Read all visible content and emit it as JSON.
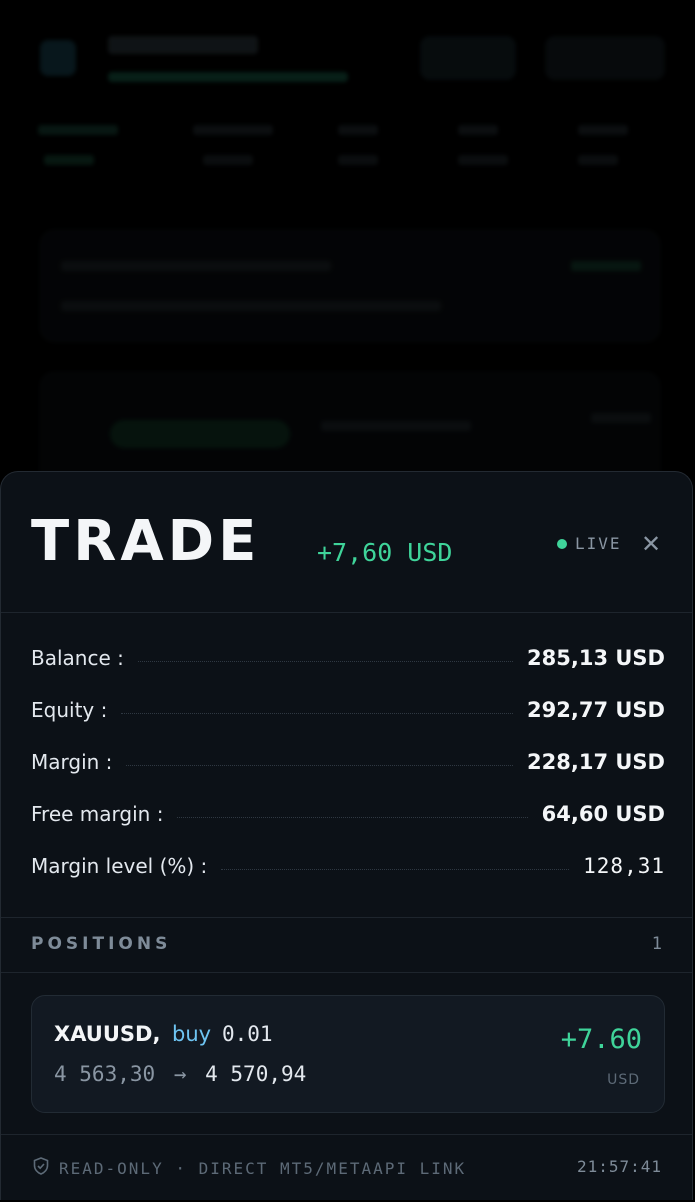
{
  "panel": {
    "title": "TRADE",
    "pnl": "+7,60 USD",
    "live_label": "LIVE",
    "close_icon": "close-icon"
  },
  "stats": [
    {
      "label": "Balance :",
      "value": "285,13 USD"
    },
    {
      "label": "Equity :",
      "value": "292,77 USD"
    },
    {
      "label": "Margin :",
      "value": "228,17 USD"
    },
    {
      "label": "Free margin :",
      "value": "64,60 USD"
    },
    {
      "label": "Margin level (%) :",
      "value": "128,31"
    }
  ],
  "positions": {
    "title": "POSITIONS",
    "count": "1",
    "items": [
      {
        "symbol": "XAUUSD,",
        "side": "buy",
        "volume": "0.01",
        "open_price": "4 563,30",
        "arrow": "→",
        "current_price": "4 570,94",
        "profit": "+7.60",
        "currency": "USD"
      }
    ]
  },
  "footer": {
    "label": "READ-ONLY · DIRECT MT5/METAAPI LINK",
    "time": "21:57:41",
    "icon": "shield-icon"
  },
  "colors": {
    "accent_green": "#3fd49a",
    "side_blue": "#6ec4f2",
    "panel_bg": "#0c1117"
  }
}
